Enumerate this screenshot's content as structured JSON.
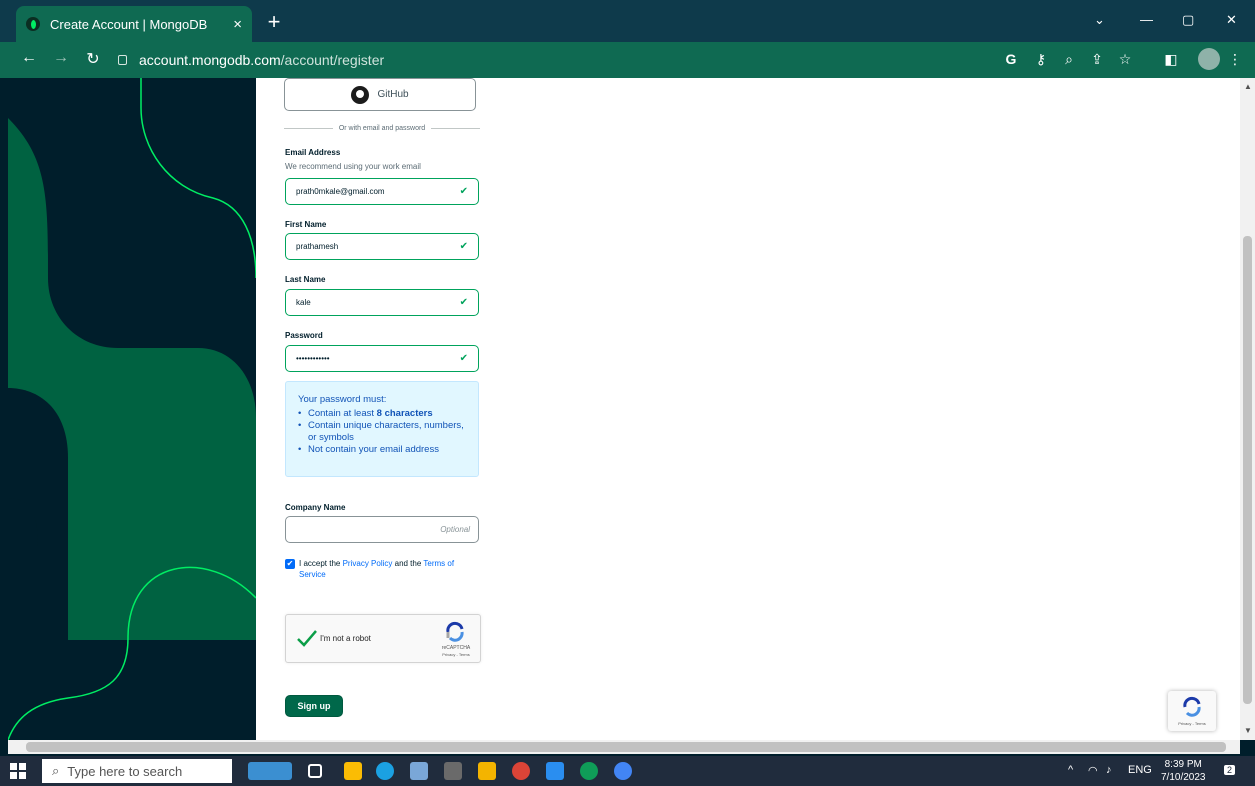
{
  "browser": {
    "tab_title": "Create Account | MongoDB",
    "tab_close": "×",
    "new_tab": "+",
    "url_domain": "account.mongodb.com",
    "url_path": "/account/register",
    "win_minimize": "—",
    "win_maximize": "▢",
    "win_close": "✕",
    "win_dropdown": "⌄"
  },
  "form": {
    "github_label": "GitHub",
    "divider_text": "Or with email and password",
    "email_label": "Email Address",
    "email_hint": "We recommend using your work email",
    "email_value": "prath0mkale@gmail.com",
    "first_name_label": "First Name",
    "first_name_value": "prathamesh",
    "last_name_label": "Last Name",
    "last_name_value": "kale",
    "password_label": "Password",
    "password_value": "••••••••••••",
    "password_rules_title": "Your password must:",
    "rule1_prefix": "Contain at least ",
    "rule1_bold": "8 characters",
    "rule2": "Contain unique characters, numbers, or symbols",
    "rule3": "Not contain your email address",
    "company_label": "Company Name",
    "company_placeholder": "Optional",
    "accept_prefix": "I accept the ",
    "privacy_link": "Privacy Policy",
    "accept_mid": " and the ",
    "terms_link": "Terms of Service",
    "check_mark": "✔",
    "captcha_label": "I'm not a robot",
    "captcha_brand": "reCAPTCHA",
    "captcha_terms": "Privacy - Terms",
    "signup_label": "Sign up",
    "badge_terms": "Privacy - Terms"
  },
  "taskbar": {
    "search_placeholder": "Type here to search",
    "language": "ENG",
    "time": "8:39 PM",
    "date": "7/10/2023",
    "notification_count": "2"
  },
  "colors": {
    "brand_green": "#00684a",
    "accent_green": "#00ed64",
    "dark_navy": "#001e2b",
    "link_blue": "#016bf8"
  }
}
